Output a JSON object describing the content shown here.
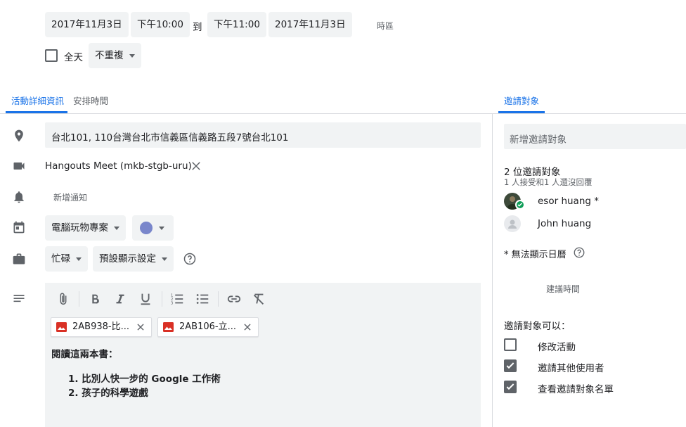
{
  "datetime": {
    "start_date": "2017年11月3日",
    "start_time": "下午10:00",
    "to_label": "到",
    "end_time": "下午11:00",
    "end_date": "2017年11月3日",
    "timezone_label": "時區"
  },
  "allday": {
    "label": "全天",
    "checked": false
  },
  "repeat": {
    "value": "不重複"
  },
  "tabs": {
    "details": "活動詳細資訊",
    "schedule": "安排時間",
    "guests": "邀請對象"
  },
  "details": {
    "location": "台北101, 110台灣台北市信義區信義路五段7號台北101",
    "conference": "Hangouts Meet (mkb-stgb-uru)",
    "add_notification": "新增通知",
    "calendar": "電腦玩物專案",
    "calendar_color": "#7986cb",
    "busy": "忙碌",
    "visibility": "預設顯示設定"
  },
  "editor": {
    "attachments": [
      {
        "name": "2AB938-比..."
      },
      {
        "name": "2AB106-立..."
      }
    ],
    "heading": "閱讀這兩本書：",
    "list": [
      {
        "num": "1.",
        "text": "比別人快一步的 Google 工作術"
      },
      {
        "num": "2.",
        "text": "孩子的科學遊戲"
      }
    ]
  },
  "guests": {
    "add_placeholder": "新增邀請對象",
    "count_label": "2 位邀請對象",
    "summary": "1 人接受和1 人還沒回覆",
    "list": [
      {
        "name": "esor huang *"
      },
      {
        "name": "John huang"
      }
    ],
    "cannot_show": "* 無法顯示日曆",
    "suggest_time": "建議時間",
    "permissions_title": "邀請對象可以：",
    "permissions": [
      {
        "label": "修改活動",
        "checked": false
      },
      {
        "label": "邀請其他使用者",
        "checked": true
      },
      {
        "label": "查看邀請對象名單",
        "checked": true
      }
    ]
  },
  "colors": {
    "accent": "#1a73e8",
    "accepted_green": "#0f9d58",
    "attachment_red": "#d93025"
  }
}
